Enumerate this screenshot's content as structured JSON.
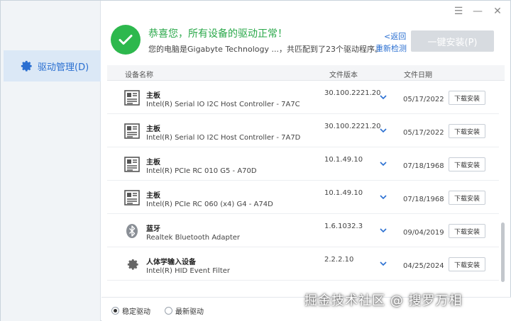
{
  "window": {
    "controls": {
      "menu": "☰",
      "minimize": "—",
      "close": "✕"
    }
  },
  "sidebar": {
    "items": [
      {
        "label": "驱动管理(D)",
        "icon": "gear-icon",
        "active": true
      }
    ]
  },
  "header": {
    "title": "恭喜您，所有设备的驱动正常！",
    "subtitle": "您的电脑是Gigabyte Technology ...，共匹配到了23个驱动程序。",
    "back_link": "<返回",
    "rescan_link": "重新检测",
    "install_all_label": "一键安装(P)",
    "status_color": "#2db84d"
  },
  "table": {
    "columns": {
      "name": "设备名称",
      "version": "文件版本",
      "date": "文件日期"
    },
    "rows": [
      {
        "category": "主板",
        "name": "Intel(R) Serial IO I2C Host Controller - 7A7C",
        "version": "30.100.2221.20",
        "date": "05/17/2022",
        "action": "下载安装",
        "icon": "motherboard-icon"
      },
      {
        "category": "主板",
        "name": "Intel(R) Serial IO I2C Host Controller - 7A7D",
        "version": "30.100.2221.20",
        "date": "05/17/2022",
        "action": "下载安装",
        "icon": "motherboard-icon"
      },
      {
        "category": "主板",
        "name": "Intel(R) PCIe RC 010 G5 - A70D",
        "version": "10.1.49.10",
        "date": "07/18/1968",
        "action": "下载安装",
        "icon": "motherboard-icon"
      },
      {
        "category": "主板",
        "name": "Intel(R) PCIe RC 060 (x4) G4 - A74D",
        "version": "10.1.49.10",
        "date": "07/18/1968",
        "action": "下载安装",
        "icon": "motherboard-icon"
      },
      {
        "category": "蓝牙",
        "name": "Realtek Bluetooth Adapter",
        "version": "1.6.1032.3",
        "date": "09/04/2019",
        "action": "下载安装",
        "icon": "bluetooth-icon"
      },
      {
        "category": "人体学输入设备",
        "name": "Intel(R) HID Event Filter",
        "version": "2.2.2.10",
        "date": "04/25/2024",
        "action": "下载安装",
        "icon": "gear-icon"
      }
    ]
  },
  "footer": {
    "options": [
      {
        "label": "稳定驱动",
        "selected": true
      },
      {
        "label": "最新驱动",
        "selected": false
      }
    ]
  },
  "watermark": "掘金技术社区 @ 搜罗万相",
  "colors": {
    "accent": "#2a6fd1",
    "success": "#2db84d",
    "sidebar_active": "#dbe8f6"
  }
}
